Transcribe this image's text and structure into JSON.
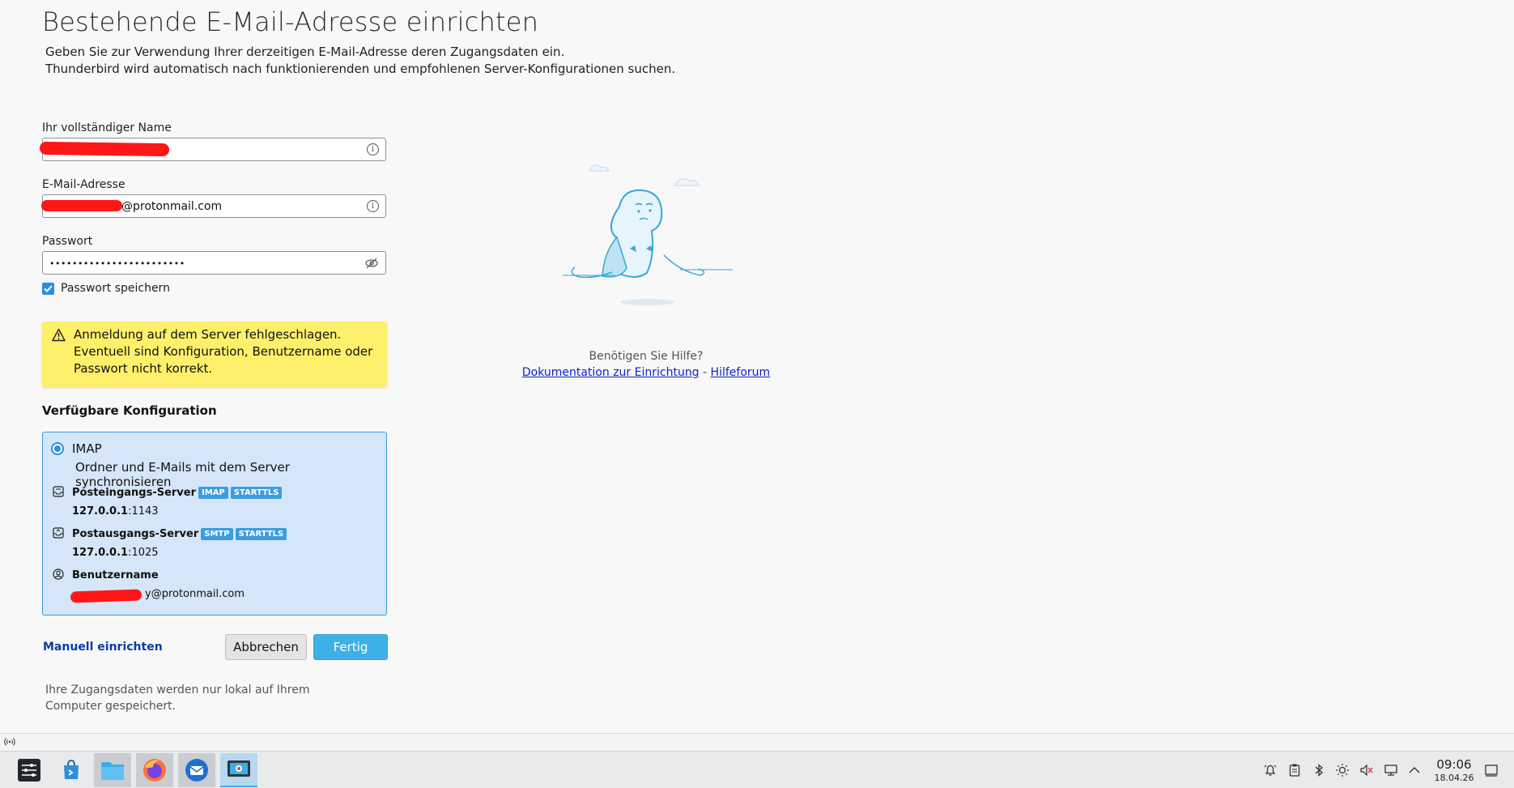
{
  "page": {
    "title": "Bestehende E-Mail-Adresse einrichten",
    "intro_line1": "Geben Sie zur Verwendung Ihrer derzeitigen E-Mail-Adresse deren Zugangsdaten ein.",
    "intro_line2": "Thunderbird wird automatisch nach funktionierenden und empfohlenen Server-Konfigurationen suchen."
  },
  "form": {
    "name_label": "Ihr vollständiger Name",
    "name_value": "",
    "email_label": "E-Mail-Adresse",
    "email_value": "@protonmail.com",
    "password_label": "Passwort",
    "password_value": "••••••••••••••••••••••••",
    "remember_label": "Passwort speichern",
    "remember_checked": true
  },
  "warning": {
    "text": "Anmeldung auf dem Server fehlgeschlagen. Eventuell sind Konfiguration, Benutzername oder Passwort nicht korrekt."
  },
  "config": {
    "section_title": "Verfügbare Konfiguration",
    "name": "IMAP",
    "description": "Ordner und E-Mails mit dem Server synchronisieren",
    "incoming": {
      "label": "Posteingangs-Server",
      "badges": [
        "IMAP",
        "STARTTLS"
      ],
      "host": "127.0.0.1",
      "port": ":1143"
    },
    "outgoing": {
      "label": "Postausgangs-Server",
      "badges": [
        "SMTP",
        "STARTTLS"
      ],
      "host": "127.0.0.1",
      "port": ":1025"
    },
    "username": {
      "label": "Benutzername",
      "value": "y@protonmail.com"
    }
  },
  "actions": {
    "manual": "Manuell einrichten",
    "cancel": "Abbrechen",
    "done": "Fertig"
  },
  "footnote": "Ihre Zugangsdaten werden nur lokal auf Ihrem Computer gespeichert.",
  "help": {
    "question": "Benötigen Sie Hilfe?",
    "doc_link": "Dokumentation zur Einrichtung",
    "separator": "-",
    "forum_link": "Hilfeforum"
  },
  "taskbar": {
    "apps": [
      "application-launcher-icon",
      "discover-icon",
      "file-manager-icon",
      "firefox-icon",
      "thunderbird-icon",
      "screenshot-tool-icon"
    ],
    "clock_time": "09:06",
    "clock_date": "18.04.26"
  },
  "colors": {
    "accent": "#3daee9",
    "warning_bg": "#fff06b",
    "config_bg": "#d4e6f7",
    "link": "#0b24c9"
  }
}
